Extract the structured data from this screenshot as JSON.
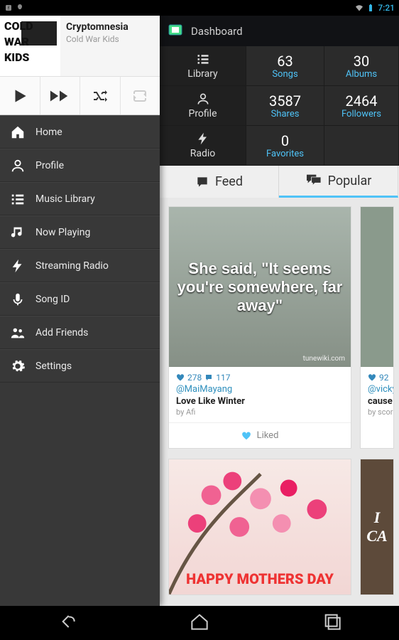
{
  "status": {
    "time": "7:21"
  },
  "now_playing": {
    "title": "Cryptomnesia",
    "artist": "Cold War Kids"
  },
  "nav": {
    "items": [
      {
        "id": "home",
        "label": "Home"
      },
      {
        "id": "profile",
        "label": "Profile"
      },
      {
        "id": "library",
        "label": "Music Library"
      },
      {
        "id": "nowplaying",
        "label": "Now Playing"
      },
      {
        "id": "radio",
        "label": "Streaming Radio"
      },
      {
        "id": "songid",
        "label": "Song ID"
      },
      {
        "id": "friends",
        "label": "Add Friends"
      },
      {
        "id": "settings",
        "label": "Settings"
      }
    ]
  },
  "actionbar": {
    "title": "Dashboard"
  },
  "dashboard": {
    "sections": [
      {
        "name": "Library",
        "stat1": {
          "value": "63",
          "label": "Songs"
        },
        "stat2": {
          "value": "30",
          "label": "Albums"
        }
      },
      {
        "name": "Profile",
        "stat1": {
          "value": "3587",
          "label": "Shares"
        },
        "stat2": {
          "value": "2464",
          "label": "Followers"
        }
      },
      {
        "name": "Radio",
        "stat1": {
          "value": "0",
          "label": "Favorites"
        }
      }
    ]
  },
  "tabs": {
    "feed": "Feed",
    "popular": "Popular"
  },
  "feed": {
    "cards": [
      {
        "image_text": "She said, \"It seems you're somewhere, far away\"",
        "likes": "278",
        "comments": "117",
        "user": "@MaiMayang",
        "title": "Love Like Winter",
        "by": "by Afi",
        "action": "Liked"
      },
      {
        "likes": "92",
        "user": "@vickyk",
        "title": "cause i l",
        "by": "by scorpio"
      },
      {
        "image_text": "HAPPY MOTHERS DAY"
      },
      {
        "image_text": "I CA"
      }
    ]
  }
}
